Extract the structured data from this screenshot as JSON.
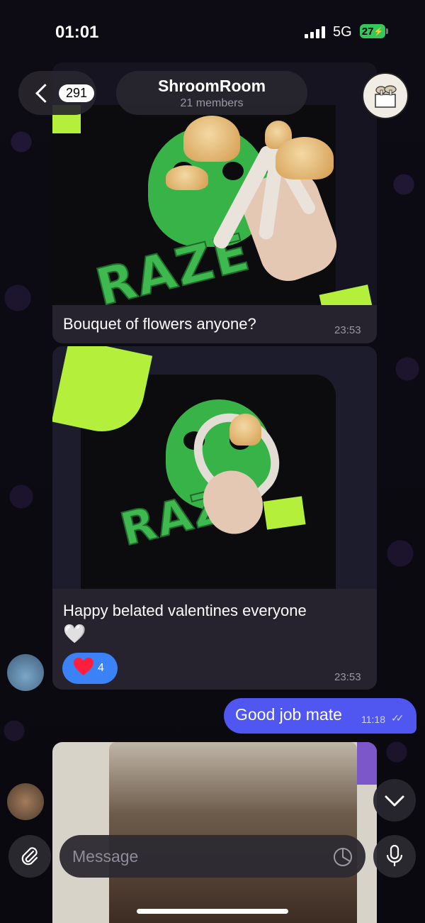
{
  "status_bar": {
    "time": "01:01",
    "network": "5G",
    "battery": "27"
  },
  "header": {
    "unread_count": "291",
    "title": "ShroomRoom",
    "subtitle": "21 members"
  },
  "messages": [
    {
      "type": "photo",
      "caption": "Bouquet of flowers anyone?",
      "time": "23:53"
    },
    {
      "type": "photo",
      "caption": "Happy belated valentines everyone",
      "emoji": "🤍",
      "reaction": {
        "emoji": "❤️",
        "count": "4"
      },
      "time": "23:53"
    },
    {
      "type": "outgoing",
      "text": "Good job mate",
      "time": "11:18",
      "status": "read"
    },
    {
      "type": "photo",
      "caption": ""
    }
  ],
  "composer": {
    "placeholder": "Message"
  },
  "colors": {
    "accent": "#4f57f0",
    "reaction": "#3b82f6",
    "battery": "#34c759"
  }
}
